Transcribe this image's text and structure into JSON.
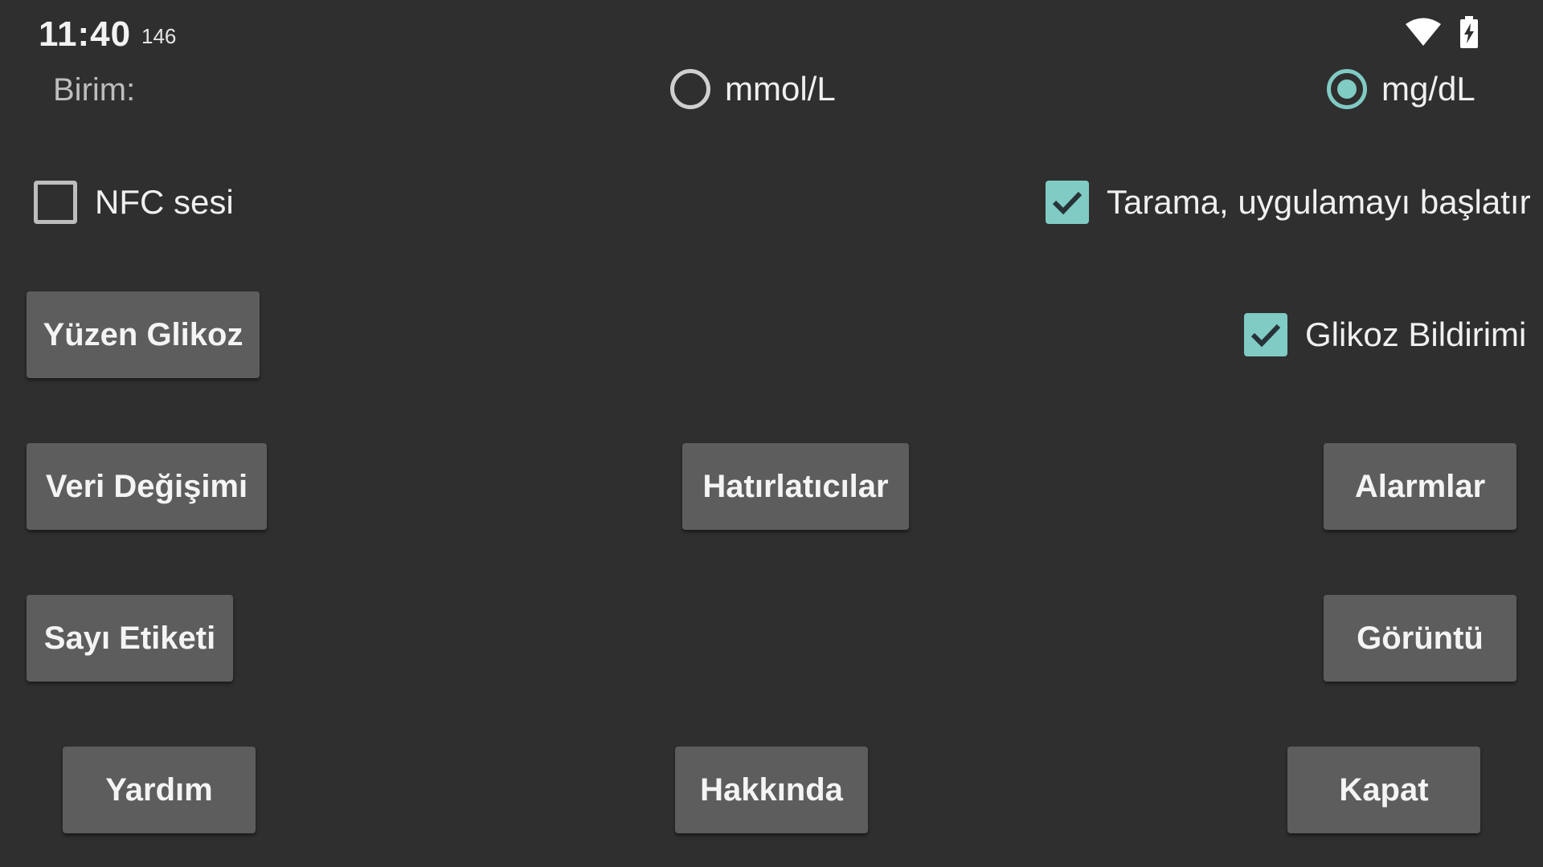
{
  "status_bar": {
    "time": "11:40",
    "extra": "146",
    "icons": [
      "wifi-icon",
      "battery-charging-icon"
    ]
  },
  "unit": {
    "label": "Birim:",
    "options": [
      {
        "label": "mmol/L",
        "selected": false
      },
      {
        "label": "mg/dL",
        "selected": true
      }
    ]
  },
  "checkboxes": {
    "nfc_sound": {
      "label": "NFC sesi",
      "checked": false
    },
    "scan_starts_app": {
      "label": "Tarama, uygulamayı başlatır",
      "checked": true
    },
    "glucose_notification": {
      "label": "Glikoz Bildirimi",
      "checked": true
    }
  },
  "buttons": {
    "floating_glucose": "Yüzen Glikoz",
    "data_exchange": "Veri Değişimi",
    "reminders": "Hatırlatıcılar",
    "alarms": "Alarmlar",
    "number_label": "Sayı Etiketi",
    "display": "Görüntü",
    "help": "Yardım",
    "about": "Hakkında",
    "close": "Kapat"
  },
  "colors": {
    "background": "#2f2f2f",
    "accent": "#80cbc4",
    "button": "#5d5d5d"
  }
}
